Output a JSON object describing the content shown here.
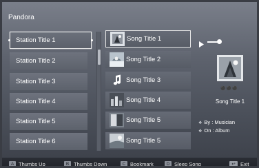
{
  "app": {
    "title": "Pandora"
  },
  "stations": [
    {
      "label": "Station Title 1",
      "selected": true
    },
    {
      "label": "Station Title 2",
      "selected": false
    },
    {
      "label": "Station Title 3",
      "selected": false
    },
    {
      "label": "Station Title 4",
      "selected": false
    },
    {
      "label": "Station Title 5",
      "selected": false
    },
    {
      "label": "Station Title 6",
      "selected": false
    }
  ],
  "songs": [
    {
      "label": "Song Title 1",
      "thumb": "album-thumb-icon",
      "selected": true
    },
    {
      "label": "Song Title 2",
      "thumb": "album-thumb-icon",
      "selected": false
    },
    {
      "label": "Song Title 3",
      "thumb": "music-note-icon",
      "selected": false
    },
    {
      "label": "Song Title 4",
      "thumb": "album-thumb-icon",
      "selected": false
    },
    {
      "label": "Song Title 5",
      "thumb": "album-thumb-icon",
      "selected": false
    },
    {
      "label": "Song Title 5",
      "thumb": "album-thumb-icon",
      "selected": false
    }
  ],
  "now_playing": {
    "title": "Song Title 1",
    "by": "By : Musician",
    "on": "On : Album",
    "play_icon": "play-icon"
  },
  "footer": {
    "items": [
      {
        "key": "A",
        "label": "Thumbs Up"
      },
      {
        "key": "B",
        "label": "Thumbs Down"
      },
      {
        "key": "C",
        "label": "Bookmark"
      },
      {
        "key": "D",
        "label": "Sleep Song"
      }
    ],
    "exit_label": "Exit",
    "exit_key_icon": "return-icon"
  },
  "colors": {
    "accent": "#ffffff",
    "panel": "#5d626c"
  }
}
